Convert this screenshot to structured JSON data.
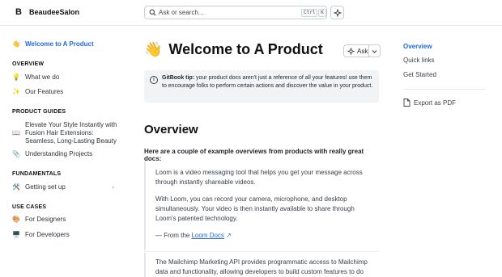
{
  "header": {
    "logo_text": "B",
    "brand": "BeaudeeSalon",
    "search_placeholder": "Ask or search...",
    "shortcut_ctrl": "Ctrl",
    "shortcut_k": "K"
  },
  "sidebar": {
    "top_item": {
      "emoji": "👋",
      "label": "Welcome to A Product"
    },
    "sections": [
      {
        "title": "OVERVIEW",
        "items": [
          {
            "emoji": "💡",
            "label": "What we do"
          },
          {
            "emoji": "✨",
            "label": "Our Features"
          }
        ]
      },
      {
        "title": "PRODUCT GUIDES",
        "items": [
          {
            "emoji": "📖",
            "label": "Elevate Your Style Instantly with Fusion Hair Extensions: Seamless, Long-Lasting Beauty"
          },
          {
            "emoji": "📎",
            "label": "Understanding Projects"
          }
        ]
      },
      {
        "title": "FUNDAMENTALS",
        "items": [
          {
            "emoji": "🛠️",
            "label": "Getting set up",
            "chevron": "›"
          }
        ]
      },
      {
        "title": "USE CASES",
        "items": [
          {
            "emoji": "🎨",
            "label": "For Designers"
          },
          {
            "emoji": "🖥️",
            "label": "For Developers"
          }
        ]
      }
    ]
  },
  "main": {
    "title_emoji": "👋",
    "title": "Welcome to A Product",
    "ask_label": "Ask",
    "hint_bold": "GitBook tip:",
    "hint_text": " your product docs aren't just a reference of all your features! use them to encourage folks to perform certain actions and discover the value in your product.",
    "overview_heading": "Overview",
    "lead": "Here are a couple of example overviews from products with really great docs:",
    "quote1": {
      "p1": "Loom is a video messaging tool that helps you get your message across through instantly shareable videos.",
      "p2": "With Loom, you can record your camera, microphone, and desktop simultaneously. Your video is then instantly available to share through Loom's patented technology.",
      "from_prefix": "— From the ",
      "link": "Loom Docs",
      "link_arrow": "↗"
    },
    "quote2": {
      "p1": "The Mailchimp Marketing API provides programmatic access to Mailchimp data and functionality, allowing developers to build custom features to do"
    }
  },
  "toc": {
    "items": [
      "Overview",
      "Quick links",
      "Get Started"
    ],
    "export_label": "Export as PDF"
  }
}
